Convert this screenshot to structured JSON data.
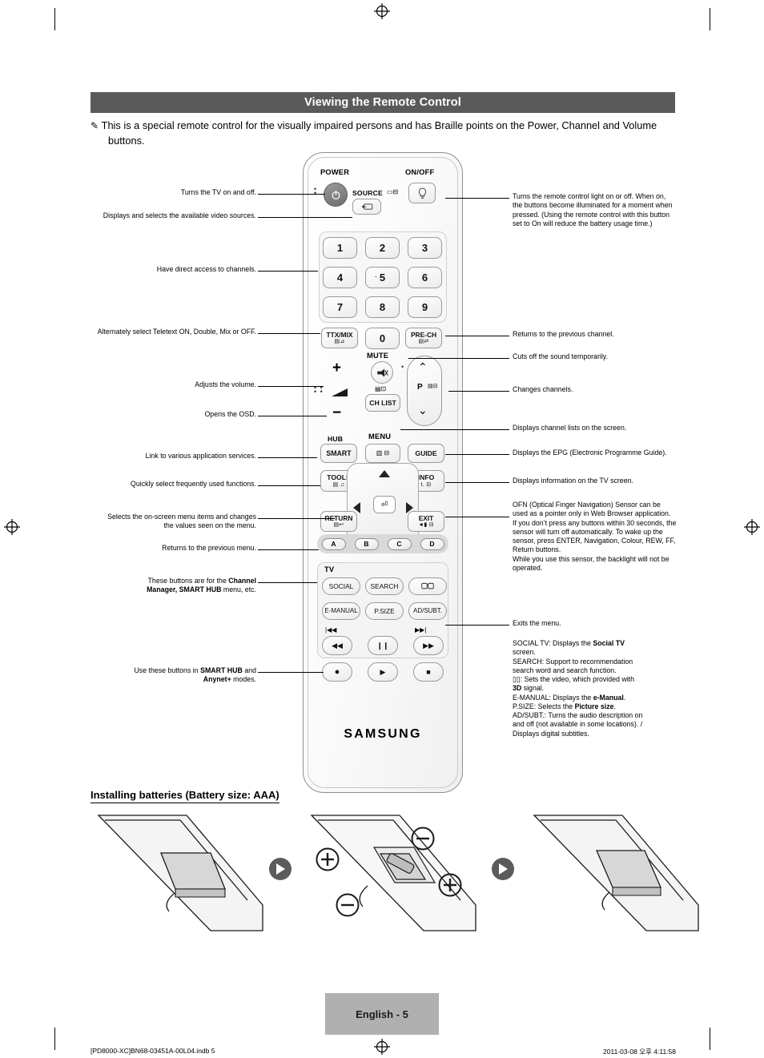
{
  "header": {
    "title": "Viewing the Remote Control"
  },
  "intro": {
    "icon": "pencil-icon",
    "text": "This is a special remote control for the visually impaired persons and has Braille points on the Power, Channel and Volume buttons."
  },
  "remote": {
    "brand": "SAMSUNG",
    "labels": {
      "power": "POWER",
      "onoff": "ON/OFF",
      "source": "SOURCE",
      "mute": "MUTE",
      "hub": "HUB",
      "menu": "MENU",
      "tv": "TV"
    },
    "buttons": {
      "source": "SOURCE",
      "n1": "1",
      "n2": "2",
      "n3": "3",
      "n4": "4",
      "n5": "5",
      "n6": "6",
      "n7": "7",
      "n8": "8",
      "n9": "9",
      "n0": "0",
      "ttxmix": "TTX/MIX",
      "prech": "PRE-CH",
      "chlist": "CH LIST",
      "p": "P",
      "smart": "SMART",
      "guide": "GUIDE",
      "tools": "TOOLS",
      "info": "INFO",
      "return": "RETURN",
      "exit": "EXIT",
      "a": "A",
      "b": "B",
      "c": "C",
      "d": "D",
      "social": "SOCIAL",
      "search": "SEARCH",
      "three_d": "3D",
      "emanual": "E-MANUAL",
      "psize": "P.SIZE",
      "adsubt": "AD/SUBT."
    }
  },
  "callouts_left": [
    {
      "id": "power",
      "text": "Turns the TV on and off."
    },
    {
      "id": "source",
      "text": "Displays and selects the available video sources."
    },
    {
      "id": "numbers",
      "text": "Have direct access to channels."
    },
    {
      "id": "ttx",
      "text": "Alternately select Teletext ON, Double, Mix or OFF."
    },
    {
      "id": "volume",
      "text": "Adjusts the volume."
    },
    {
      "id": "osd",
      "text": "Opens the OSD."
    },
    {
      "id": "smart",
      "text": "Link to various application services."
    },
    {
      "id": "tools",
      "text": "Quickly select frequently used functions."
    },
    {
      "id": "navigation",
      "text": "Selects the on-screen menu items and changes the values seen on the menu."
    },
    {
      "id": "return",
      "text": "Returns to the previous menu."
    },
    {
      "id": "colour",
      "text": "These buttons are for the Channel Manager, SMART HUB menu, etc.",
      "bold1": "Channel Manager, SMART HUB"
    },
    {
      "id": "media",
      "text": "Use these buttons in SMART HUB and Anynet+ modes.",
      "bold1": "SMART HUB",
      "bold2": "Anynet+"
    }
  ],
  "callouts_right": [
    {
      "id": "light",
      "text": "Turns the remote control light on or off. When on, the buttons become illuminated for a moment when pressed. (Using the remote control with this button set to On will reduce the battery usage time.)"
    },
    {
      "id": "prech",
      "text": "Returns to the previous channel."
    },
    {
      "id": "mute",
      "text": "Cuts off the sound temporarily."
    },
    {
      "id": "channel",
      "text": "Changes channels."
    },
    {
      "id": "chlist",
      "text": "Displays channel lists on the screen."
    },
    {
      "id": "guide",
      "text": "Displays the EPG (Electronic Programme Guide)."
    },
    {
      "id": "info",
      "text": "Displays information on the TV screen."
    },
    {
      "id": "ofn",
      "text": "OFN (Optical Finger Navigation) Sensor can be used as a pointer only in Web Browser application.\nIf you don’t press any buttons within 30 seconds, the sensor will turn off automatically. To wake up the sensor, press ENTER, Navigation, Colour, REW, FF, Return buttons.\nWhile you use this sensor, the backlight will not be operated."
    },
    {
      "id": "exit",
      "text": "Exits the menu."
    },
    {
      "id": "social",
      "text": "SOCIAL TV: Displays the Social TV screen."
    },
    {
      "id": "search",
      "text": "SEARCH: Support to recommendation search word and search function."
    },
    {
      "id": "3d",
      "text": ": Sets the video, which provided with 3D signal."
    },
    {
      "id": "emanual",
      "text": "E-MANUAL: Displays the e-Manual."
    },
    {
      "id": "psize",
      "text": "P.SIZE: Selects the Picture size."
    },
    {
      "id": "adsubt",
      "text": "AD/SUBT.: Turns the audio description on and off (not available in some locations). / Displays digital subtitles."
    }
  ],
  "batteries": {
    "title": "Installing batteries (Battery size: AAA)",
    "plus": "+",
    "minus": "−"
  },
  "footer": {
    "page": "English - 5",
    "left": "[PD8000-XC]BN68-03451A-00L04.indb   5",
    "right": "2011-03-08   오후 4:11:58"
  }
}
